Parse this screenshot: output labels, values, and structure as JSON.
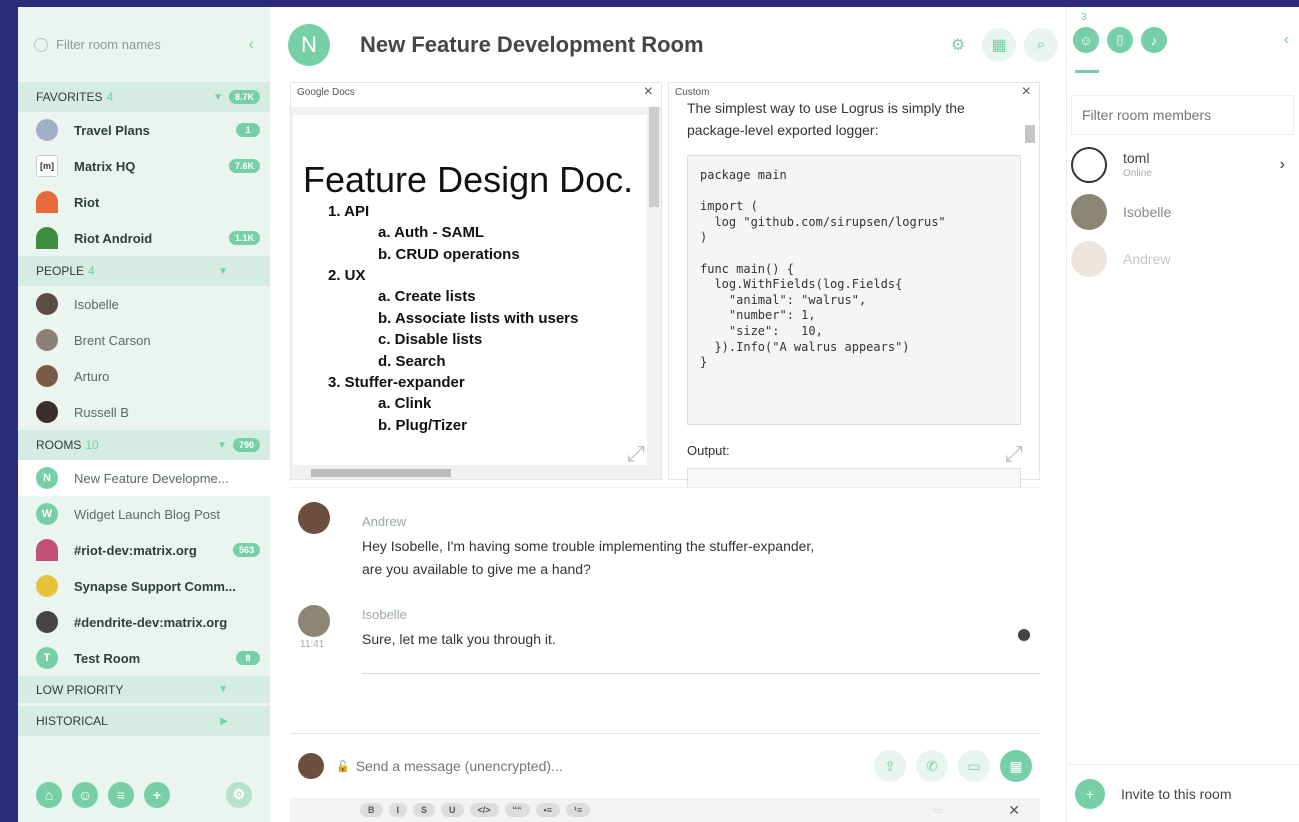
{
  "sidebar": {
    "filter_placeholder": "Filter room names",
    "favorites": {
      "label": "FAVORITES",
      "count": "4",
      "badge": "8.7K",
      "rooms": [
        {
          "name": "Travel Plans",
          "badge": "1",
          "color": "#6a7f9a"
        },
        {
          "name": "Matrix HQ",
          "badge": "7.6K",
          "color": "#ffffff"
        },
        {
          "name": "Riot",
          "badge": "",
          "color": "#e66b3c"
        },
        {
          "name": "Riot Android",
          "badge": "1.1K",
          "color": "#3d8f3d"
        }
      ]
    },
    "people": {
      "label": "PEOPLE",
      "count": "4",
      "members": [
        "Isobelle",
        "Brent Carson",
        "Arturo",
        "Russell B"
      ]
    },
    "rooms": {
      "label": "ROOMS",
      "count": "10",
      "badge": "790",
      "list": [
        {
          "name": "New Feature Developme...",
          "badge": "",
          "letter": "N",
          "color": "#76cfa6",
          "bold": false
        },
        {
          "name": "Widget Launch Blog Post",
          "badge": "",
          "letter": "W",
          "color": "#76cfa6",
          "bold": false
        },
        {
          "name": "#riot-dev:matrix.org",
          "badge": "563",
          "letter": "",
          "color": "#c0507a",
          "bold": true
        },
        {
          "name": "Synapse Support Comm...",
          "badge": "",
          "letter": "",
          "color": "#e8c23a",
          "bold": true
        },
        {
          "name": "#dendrite-dev:matrix.org",
          "badge": "",
          "letter": "",
          "color": "#444444",
          "bold": true
        },
        {
          "name": "Test Room",
          "badge": "8",
          "letter": "T",
          "color": "#76cfa6",
          "bold": true
        }
      ]
    },
    "low_priority": "LOW PRIORITY",
    "historical": "HISTORICAL"
  },
  "header": {
    "avatar_letter": "N",
    "room_name": "New Feature Development Room"
  },
  "widgets": {
    "gdocs": {
      "title": "Google Docs",
      "doc_title": "Feature Design Doc.",
      "items": [
        {
          "level": 1,
          "text": "1.  API"
        },
        {
          "level": 2,
          "text": "a.  Auth - SAML"
        },
        {
          "level": 2,
          "text": "b.  CRUD operations"
        },
        {
          "level": 1,
          "text": "2.  UX"
        },
        {
          "level": 2,
          "text": "a.  Create lists"
        },
        {
          "level": 2,
          "text": "b.  Associate lists with users"
        },
        {
          "level": 2,
          "text": "c.  Disable lists"
        },
        {
          "level": 2,
          "text": "d.  Search"
        },
        {
          "level": 1,
          "text": "3.  Stuffer-expander"
        },
        {
          "level": 2,
          "text": "a.  Clink"
        },
        {
          "level": 2,
          "text": "b.  Plug/Tizer"
        }
      ]
    },
    "custom": {
      "title": "Custom",
      "intro": "The simplest way to use Logrus is simply the package-level exported logger:",
      "code": "package main\n\nimport (\n  log \"github.com/sirupsen/logrus\"\n)\n\nfunc main() {\n  log.WithFields(log.Fields{\n    \"animal\": \"walrus\",\n    \"number\": 1,\n    \"size\":   10,\n  }).Info(\"A walrus appears\")\n}",
      "output_label": "Output:"
    }
  },
  "timeline": [
    {
      "sender": "Andrew",
      "body1": "Hey Isobelle, I'm having some trouble implementing the stuffer-expander,",
      "body2": "are you available to give me a hand?",
      "ts": ""
    },
    {
      "sender": "Isobelle",
      "body1": "Sure, let me talk you through it.",
      "body2": "",
      "ts": "11:41"
    }
  ],
  "composer": {
    "placeholder": "Send a message (unencrypted)..."
  },
  "format_buttons": [
    "B",
    "I",
    "S",
    "U",
    "</>",
    "““",
    "•≡",
    "¹≡"
  ],
  "right_panel": {
    "member_count": "3",
    "filter_placeholder": "Filter room members",
    "members": [
      {
        "name": "toml",
        "status": "Online"
      },
      {
        "name": "Isobelle",
        "status": ""
      },
      {
        "name": "Andrew",
        "status": ""
      }
    ],
    "invite_label": "Invite to this room"
  },
  "colors": {
    "accent": "#76cfa6",
    "sidebar_bg": "#eaf5f0",
    "section_bg": "#d4ece2"
  }
}
